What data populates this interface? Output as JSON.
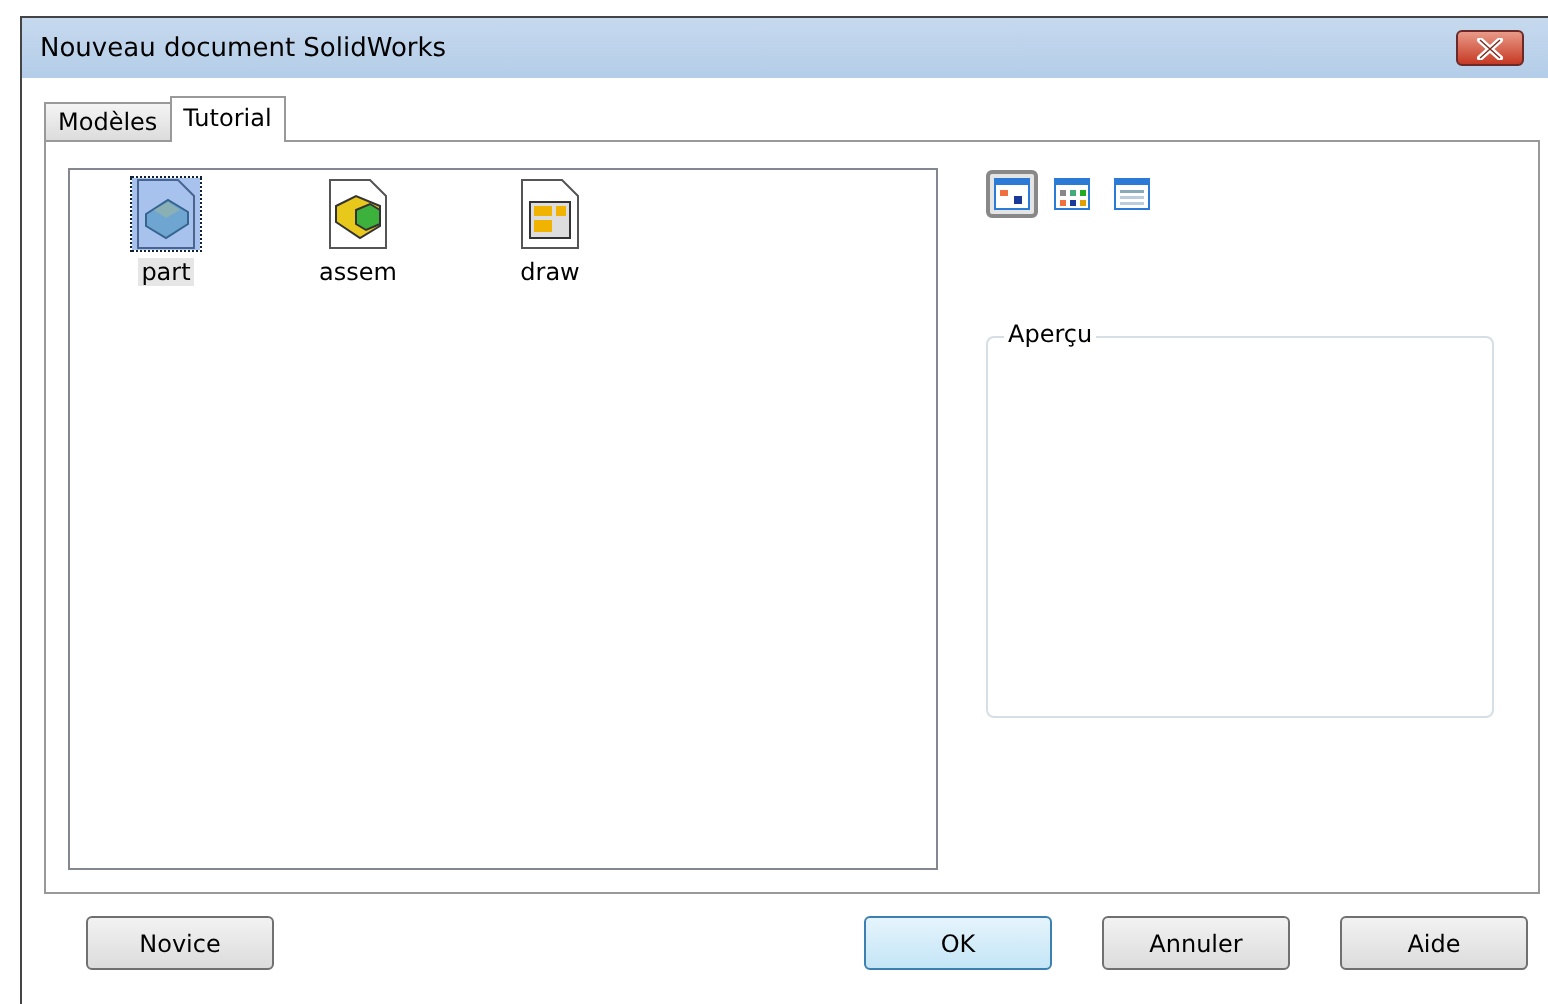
{
  "window": {
    "title": "Nouveau document SolidWorks"
  },
  "tabs": [
    {
      "label": "Modèles",
      "selected": false
    },
    {
      "label": "Tutorial",
      "selected": true
    }
  ],
  "templates": [
    {
      "label": "part",
      "kind": "part",
      "selected": true
    },
    {
      "label": "assem",
      "kind": "assembly",
      "selected": false
    },
    {
      "label": "draw",
      "kind": "drawing",
      "selected": false
    }
  ],
  "view_buttons": [
    {
      "kind": "large",
      "selected": true
    },
    {
      "kind": "list",
      "selected": false
    },
    {
      "kind": "details",
      "selected": false
    }
  ],
  "preview": {
    "label": "Aperçu"
  },
  "buttons": [
    {
      "label": "Novice",
      "default": false
    },
    {
      "label": "OK",
      "default": true
    },
    {
      "label": "Annuler",
      "default": false
    },
    {
      "label": "Aide",
      "default": false
    }
  ]
}
